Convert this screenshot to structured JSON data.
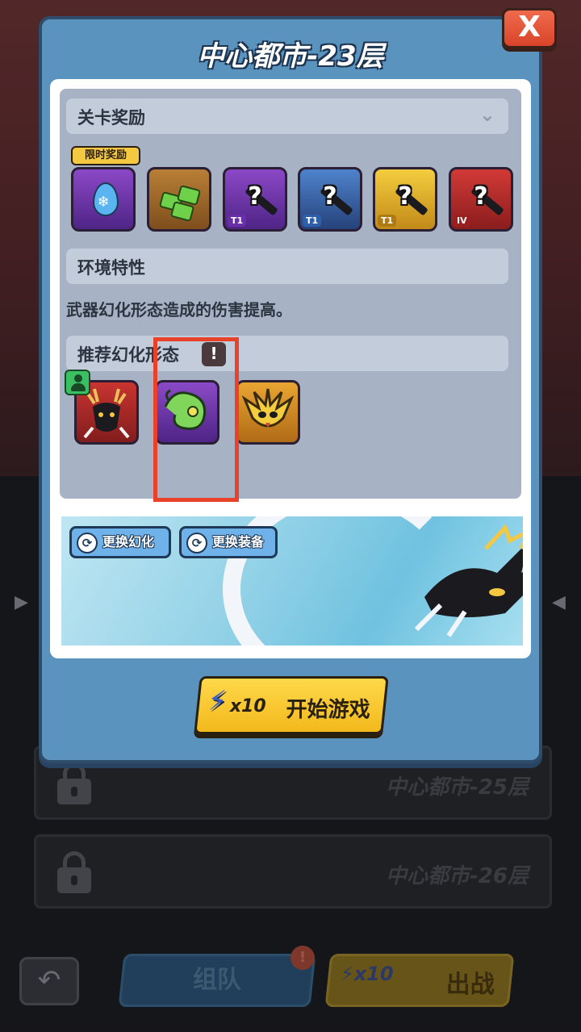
{
  "modal": {
    "title": "中心都市-23层",
    "close_label": "X"
  },
  "rewards": {
    "header": "关卡奖励",
    "limited_tag": "限时奖励",
    "items": [
      {
        "name": "ice-drop",
        "tier": ""
      },
      {
        "name": "green-gems",
        "tier": ""
      },
      {
        "name": "purple-weapon",
        "mark": "?",
        "tier": "T1"
      },
      {
        "name": "blue-weapon",
        "mark": "?",
        "tier": "T1"
      },
      {
        "name": "gold-weapon",
        "mark": "?",
        "tier": "T1"
      },
      {
        "name": "red-weapon",
        "mark": "?",
        "tier": "IV"
      }
    ]
  },
  "environment": {
    "header": "环境特性",
    "description": "武器幻化形态造成的伤害提高。"
  },
  "recommended": {
    "header": "推荐幻化形态",
    "forms": [
      "deer-beast",
      "green-serpent",
      "golden-bird"
    ]
  },
  "preview": {
    "change_form_label": "更换幻化",
    "change_gear_label": "更换装备"
  },
  "start": {
    "cost": "x10",
    "label": "开始游戏"
  },
  "background": {
    "locked_levels": [
      "中心都市-25层",
      "中心都市-26层"
    ],
    "team_label": "组队",
    "team_badge": "!",
    "fight_cost": "x10",
    "fight_label": "出战"
  }
}
